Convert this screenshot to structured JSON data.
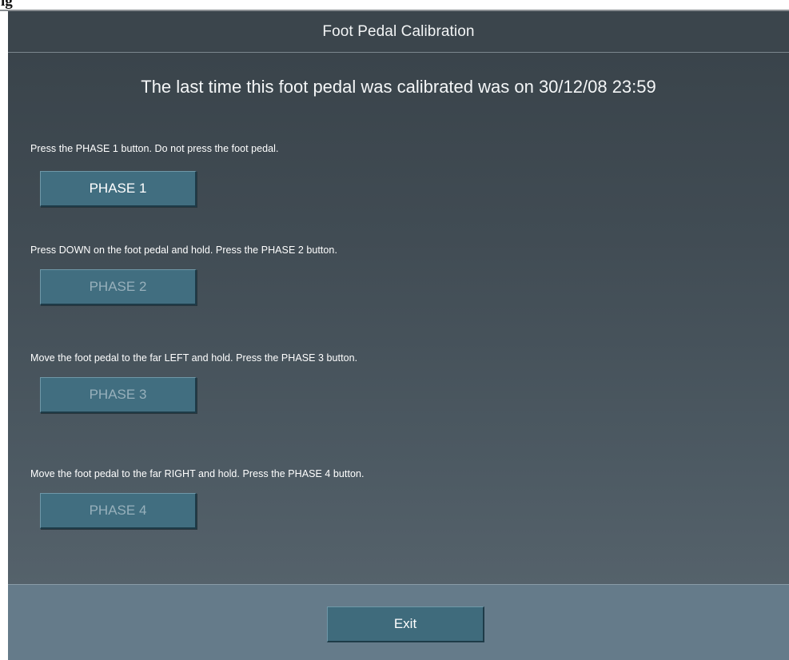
{
  "header_fragment": "ig",
  "window": {
    "title": "Foot Pedal Calibration"
  },
  "calibration": {
    "last_calibrated_text": "The last time this foot pedal was calibrated was on 30/12/08 23:59"
  },
  "phases": [
    {
      "instruction": "Press the PHASE 1 button. Do not press the foot pedal.",
      "button_label": "PHASE 1",
      "enabled": true
    },
    {
      "instruction": "Press DOWN on the foot pedal and hold. Press the PHASE 2 button.",
      "button_label": "PHASE 2",
      "enabled": false
    },
    {
      "instruction": "Move the foot pedal to the far LEFT and hold. Press the PHASE 3 button.",
      "button_label": "PHASE 3",
      "enabled": false
    },
    {
      "instruction": "Move the foot pedal to the far RIGHT and hold. Press the PHASE 4 button.",
      "button_label": "PHASE 4",
      "enabled": false
    }
  ],
  "footer": {
    "exit_label": "Exit"
  },
  "colors": {
    "window_background": "#445058",
    "title_bar": "#3b454c",
    "footer_background": "#657b8a",
    "button_background": "#416e80",
    "button_text_enabled": "#ffffff",
    "button_text_disabled": "#97b0bb"
  }
}
